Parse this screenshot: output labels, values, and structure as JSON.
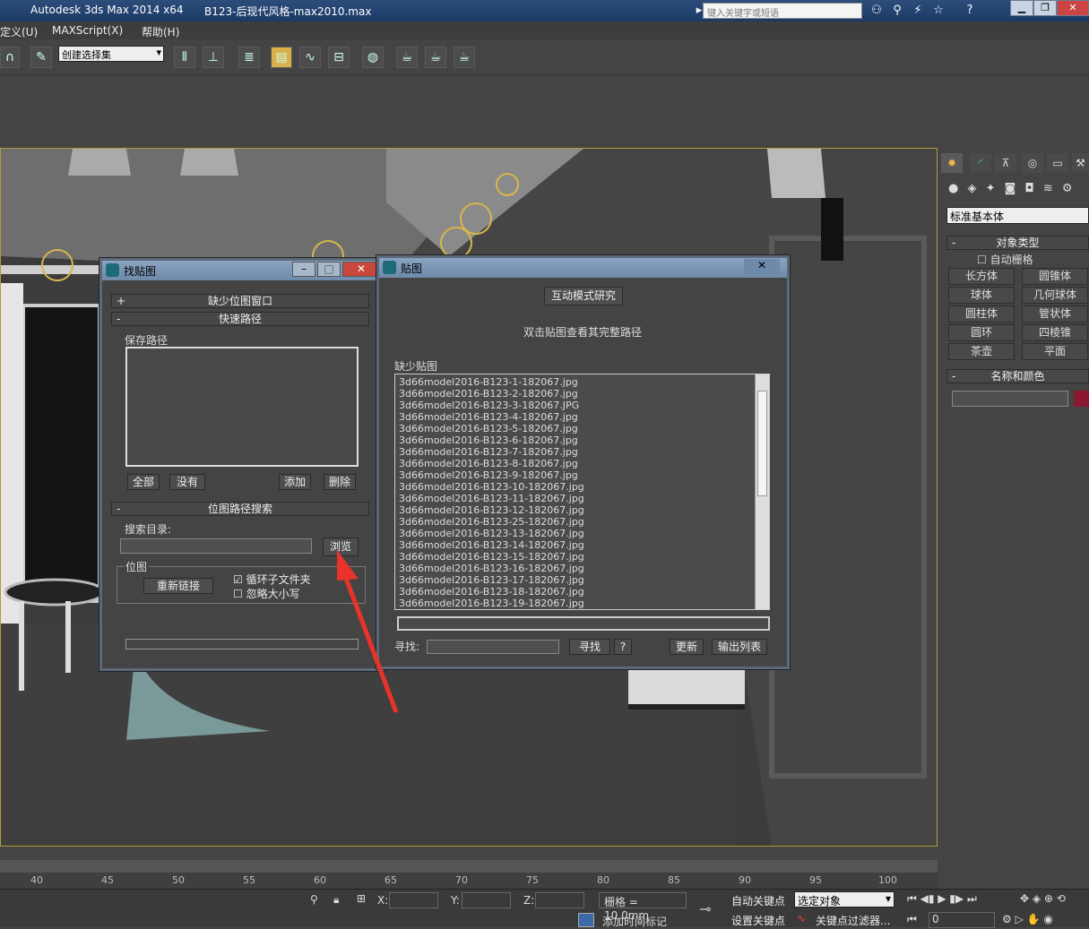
{
  "titlebar": {
    "app": "Autodesk 3ds Max  2014 x64",
    "file": "B123-后现代风格-max2010.max",
    "search_placeholder": "键入关键字或短语"
  },
  "menu": {
    "items": [
      "定义(U)",
      "MAXScript(X)",
      "帮助(H)"
    ]
  },
  "toolbar": {
    "selection_set": "创建选择集"
  },
  "right_panel": {
    "dropdown": "标准基本体",
    "object_type_title": "对象类型",
    "auto_grid": "自动栅格",
    "buttons": [
      "长方体",
      "圆锥体",
      "球体",
      "几何球体",
      "圆柱体",
      "管状体",
      "圆环",
      "四棱锥",
      "茶壶",
      "平面"
    ],
    "name_color_title": "名称和颜色",
    "color": "#8a1830"
  },
  "find_dialog": {
    "title": "找贴图",
    "section_missing": "缺少位图窗口",
    "section_quick": "快速路径",
    "save_path_label": "保存路径",
    "buttons": {
      "all": "全部",
      "none": "没有",
      "add": "添加",
      "delete": "删除"
    },
    "section_search": "位图路径搜索",
    "search_dir_label": "搜索目录:",
    "browse": "浏览",
    "bitmap_group": "位图",
    "relink": "重新链接",
    "loop_subfolders": "循环子文件夹",
    "ignore_case": "忽略大小写"
  },
  "map_dialog": {
    "title": "贴图",
    "interactive_btn": "互动模式研究",
    "hint": "双击贴图查看其完整路径",
    "missing_label": "缺少贴图",
    "files": [
      "3d66model2016-B123-1-182067.jpg",
      "3d66model2016-B123-2-182067.jpg",
      "3d66model2016-B123-3-182067.JPG",
      "3d66model2016-B123-4-182067.jpg",
      "3d66model2016-B123-5-182067.jpg",
      "3d66model2016-B123-6-182067.jpg",
      "3d66model2016-B123-7-182067.jpg",
      "3d66model2016-B123-8-182067.jpg",
      "3d66model2016-B123-9-182067.jpg",
      "3d66model2016-B123-10-182067.jpg",
      "3d66model2016-B123-11-182067.jpg",
      "3d66model2016-B123-12-182067.jpg",
      "3d66model2016-B123-25-182067.jpg",
      "3d66model2016-B123-13-182067.jpg",
      "3d66model2016-B123-14-182067.jpg",
      "3d66model2016-B123-15-182067.jpg",
      "3d66model2016-B123-16-182067.jpg",
      "3d66model2016-B123-17-182067.jpg",
      "3d66model2016-B123-18-182067.jpg",
      "3d66model2016-B123-19-182067.jpg"
    ],
    "find_label": "寻找:",
    "find_btn": "寻找",
    "help_btn": "?",
    "update_btn": "更新",
    "export_btn": "输出列表"
  },
  "timeline": {
    "ticks": [
      "40",
      "45",
      "50",
      "55",
      "60",
      "65",
      "70",
      "75",
      "80",
      "85",
      "90",
      "95",
      "100"
    ]
  },
  "status": {
    "x_label": "X:",
    "y_label": "Y:",
    "z_label": "Z:",
    "grid": "栅格 = 10.0mm",
    "auto_key": "自动关键点",
    "selected": "选定对象",
    "set_key": "设置关键点",
    "key_filter": "关键点过滤器...",
    "add_time_tag": "添加时间标记",
    "frame": "0"
  }
}
